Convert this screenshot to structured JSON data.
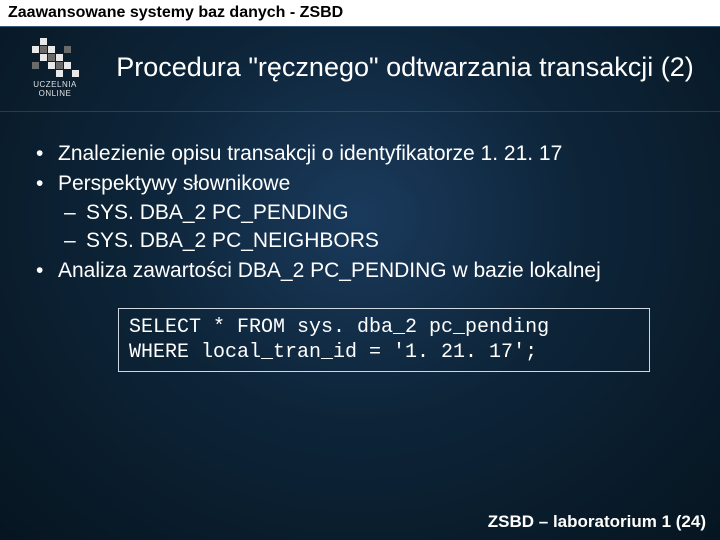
{
  "header": {
    "course": "Zaawansowane systemy baz danych - ZSBD"
  },
  "logo": {
    "line1": "UCZELNIA",
    "line2": "ONLINE"
  },
  "title": "Procedura \"ręcznego\" odtwarzania transakcji (2)",
  "bullets": {
    "b1": "Znalezienie opisu transakcji o identyfikatorze 1. 21. 17",
    "b2": "Perspektywy słownikowe",
    "b2a": "SYS. DBA_2 PC_PENDING",
    "b2b": "SYS. DBA_2 PC_NEIGHBORS",
    "b3": "Analiza zawartości DBA_2 PC_PENDING w bazie lokalnej"
  },
  "code": "SELECT * FROM sys. dba_2 pc_pending\nWHERE local_tran_id = '1. 21. 17';",
  "footer": "ZSBD – laboratorium 1 (24)"
}
